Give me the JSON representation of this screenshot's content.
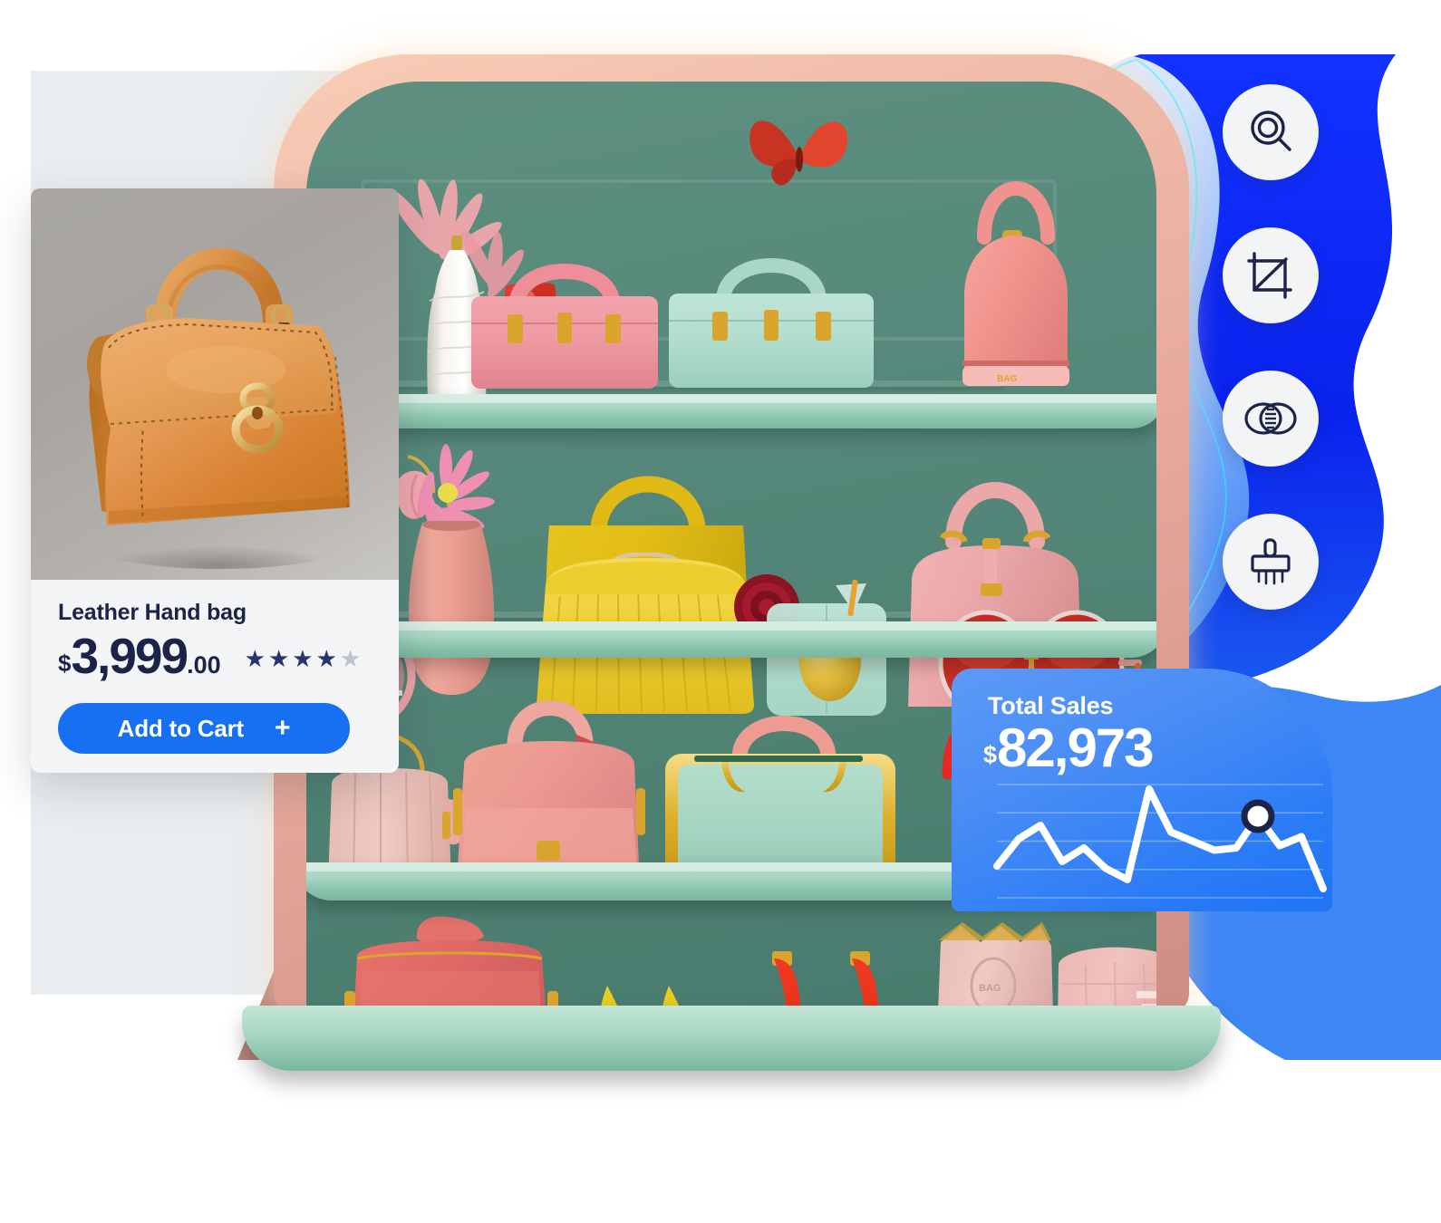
{
  "theme": {
    "accent_blue": "#1770f2",
    "widget_blue": "#3b83f6",
    "navy_text": "#1b2348",
    "card_bg": "#f4f5f7",
    "panel_grey": "#e9edf0",
    "cabinet_pink": "#eab4a3",
    "shelf_mint": "#a6d6c2",
    "wall_green": "#537f72",
    "star_filled": "#26356b",
    "star_empty": "#bcc3cf"
  },
  "product_card": {
    "title": "Leather Hand bag",
    "price": {
      "currency": "$",
      "amount": "3,999",
      "cents": ".00"
    },
    "rating": {
      "value": 4,
      "max": 5,
      "filled_glyph": "★",
      "empty_glyph": "★"
    },
    "cta": {
      "label": "Add to Cart",
      "plus": "+"
    },
    "photo_alt": "tan leather handbag with ring clasp"
  },
  "toolbar": {
    "items": [
      {
        "name": "search-icon",
        "label": "Search"
      },
      {
        "name": "crop-icon",
        "label": "Crop"
      },
      {
        "name": "blend-intersect-icon",
        "label": "Blend"
      },
      {
        "name": "brush-icon",
        "label": "Brush"
      }
    ]
  },
  "sales_widget": {
    "label": "Total Sales",
    "currency": "$",
    "value": "82,973"
  },
  "chart_data": {
    "type": "line",
    "title": "Total Sales",
    "xlabel": "",
    "ylabel": "",
    "grid": true,
    "gridlines": 5,
    "legend": null,
    "x": [
      0,
      1,
      2,
      3,
      4,
      5,
      6,
      7,
      8,
      9,
      10,
      11,
      12,
      13,
      14,
      15
    ],
    "values": [
      28,
      52,
      64,
      32,
      44,
      26,
      16,
      96,
      58,
      50,
      42,
      44,
      72,
      46,
      54,
      8
    ],
    "ylim": [
      0,
      100
    ],
    "series": [
      {
        "name": "Sales",
        "color": "#ffffff",
        "values": [
          28,
          52,
          64,
          32,
          44,
          26,
          16,
          96,
          58,
          50,
          42,
          44,
          72,
          46,
          54,
          8
        ]
      }
    ],
    "highlight_point": {
      "x": 12,
      "y": 72,
      "marker": "circle",
      "fill": "#ffffff",
      "stroke": "#1b2348"
    }
  },
  "shelf_scene": {
    "alt": "3D pastel display cabinet with designer handbags",
    "shelves": [
      {
        "index": 1,
        "items": [
          "white ribbed vase",
          "pink lotus flower",
          "pink box handbag",
          "mint box handbag",
          "coral dome bag",
          "red butterfly"
        ]
      },
      {
        "index": 2,
        "items": [
          "pink sunglasses",
          "pink vase with daisy and tulip",
          "yellow tote bag",
          "pleated yellow clutch",
          "red rose",
          "mint bag with gold orb",
          "pink doctor bag",
          "red round sunglasses"
        ]
      },
      {
        "index": 3,
        "items": [
          "blush ribbed vanity case",
          "coral pink doctor bag",
          "mint bag with gold trim",
          "red handle bag"
        ]
      },
      {
        "index": 4,
        "items": [
          "coral vanity case",
          "yellow pumps",
          "red heels",
          "blush pouch bag",
          "pink croc bag"
        ]
      }
    ]
  }
}
